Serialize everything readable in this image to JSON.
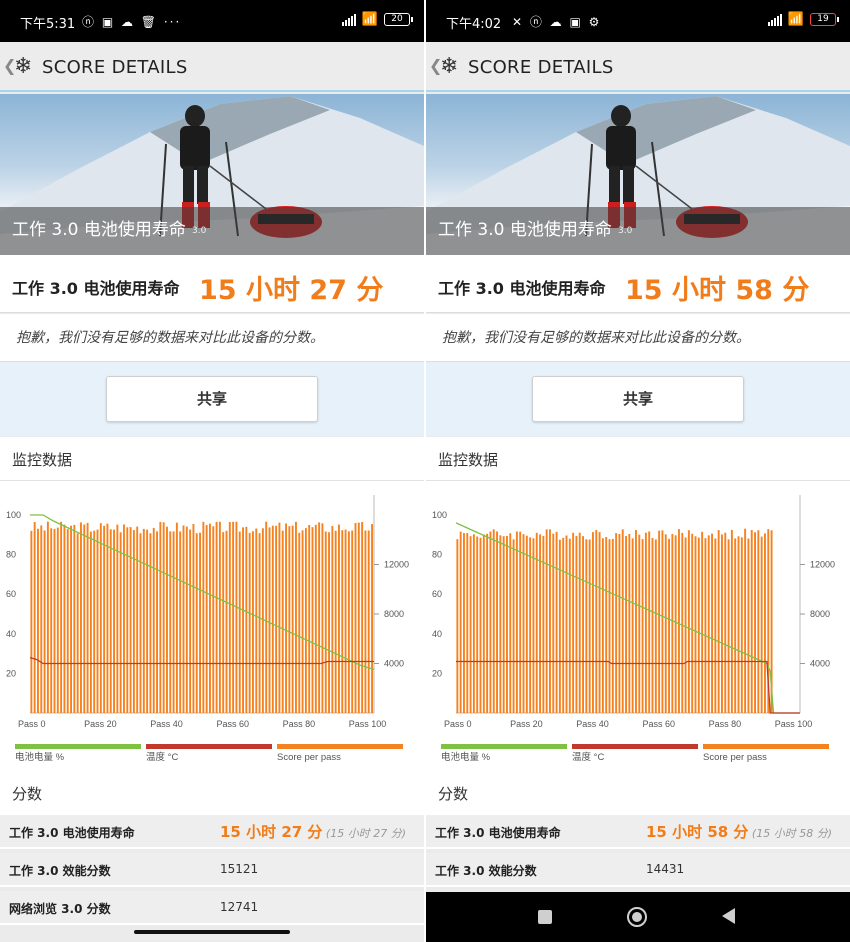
{
  "screens": [
    {
      "status": {
        "time": "下午5:31",
        "icons": "ⓝ ▣ ☁ 🗑 ···",
        "battery": "20"
      },
      "header": {
        "title": "SCORE DETAILS"
      },
      "hero": {
        "caption": "工作 3.0 电池使用寿命",
        "version": "3.0"
      },
      "score": {
        "label": "工作 3.0 电池使用寿命",
        "value": "15 小时 27 分"
      },
      "notice": "抱歉，我们没有足够的数据来对比此设备的分数。",
      "share_label": "共享",
      "monitor_title": "监控数据",
      "scores_title": "分数",
      "rows": [
        {
          "label": "工作 3.0 电池使用寿命",
          "value": "15 小时 27 分",
          "sub": "(15 小时 27 分)"
        },
        {
          "label": "工作 3.0 效能分数",
          "value": "15121"
        },
        {
          "label": "网络浏览 3.0 分数",
          "value": "12741"
        }
      ],
      "chart_data": {
        "type": "bar",
        "x_ticks": [
          "Pass 0",
          "Pass 20",
          "Pass 40",
          "Pass 60",
          "Pass 80",
          "Pass 100"
        ],
        "x_range": [
          0,
          104
        ],
        "y_left_ticks": [
          "100",
          "80",
          "60",
          "40",
          "20"
        ],
        "y_left_range": [
          0,
          100
        ],
        "y_right_ticks": [
          "12000",
          "8000",
          "4000"
        ],
        "y_right_range": [
          0,
          16000
        ],
        "legend": [
          "电池电量 %",
          "温度 °C",
          "Score per pass"
        ],
        "series": [
          {
            "name": "电池电量 %",
            "color": "#7dc242",
            "points": [
              [
                0,
                100
              ],
              [
                4,
                100
              ],
              [
                7,
                97
              ],
              [
                100,
                24
              ],
              [
                104,
                22
              ]
            ]
          },
          {
            "name": "温度 °C",
            "color": "#c0392b",
            "points": [
              [
                0,
                28
              ],
              [
                2,
                27
              ],
              [
                4,
                25
              ],
              [
                88,
                25
              ],
              [
                90,
                26
              ],
              [
                104,
                26
              ]
            ]
          },
          {
            "name": "Score per pass",
            "color": "#f58220",
            "bar_count": 104,
            "typical": 15121,
            "range": [
              14500,
              15500
            ]
          }
        ]
      }
    },
    {
      "status": {
        "time": "下午4:02",
        "icons": "✕ ⓝ ☁ ▣ ⚙",
        "battery": "19"
      },
      "header": {
        "title": "SCORE DETAILS"
      },
      "hero": {
        "caption": "工作 3.0 电池使用寿命",
        "version": "3.0"
      },
      "score": {
        "label": "工作 3.0 电池使用寿命",
        "value": "15 小时 58 分"
      },
      "notice": "抱歉，我们没有足够的数据来对比此设备的分数。",
      "share_label": "共享",
      "monitor_title": "监控数据",
      "scores_title": "分数",
      "rows": [
        {
          "label": "工作 3.0 电池使用寿命",
          "value": "15 小时 58 分",
          "sub": "(15 小时 58 分)"
        },
        {
          "label": "工作 3.0 效能分数",
          "value": "14431"
        }
      ],
      "chart_data": {
        "type": "bar",
        "x_ticks": [
          "Pass 0",
          "Pass 20",
          "Pass 40",
          "Pass 60",
          "Pass 80",
          "Pass 100"
        ],
        "x_range": [
          0,
          104
        ],
        "y_left_ticks": [
          "100",
          "80",
          "60",
          "40",
          "20"
        ],
        "y_left_range": [
          0,
          100
        ],
        "y_right_ticks": [
          "12000",
          "8000",
          "4000"
        ],
        "y_right_range": [
          0,
          16000
        ],
        "legend": [
          "电池电量 %",
          "温度 °C",
          "Score per pass"
        ],
        "series": [
          {
            "name": "电池电量 %",
            "color": "#7dc242",
            "points": [
              [
                0,
                96
              ],
              [
                94,
                25
              ],
              [
                95,
                21
              ],
              [
                96,
                0
              ],
              [
                104,
                0
              ]
            ]
          },
          {
            "name": "温度 °C",
            "color": "#c0392b",
            "points": [
              [
                0,
                26
              ],
              [
                46,
                26
              ],
              [
                47,
                25
              ],
              [
                69,
                25
              ],
              [
                70,
                26
              ],
              [
                94,
                26
              ],
              [
                95,
                0
              ],
              [
                104,
                0
              ]
            ]
          },
          {
            "name": "Score per pass",
            "color": "#f58220",
            "bar_count": 96,
            "typical": 14431,
            "range": [
              14000,
              14900
            ]
          }
        ]
      }
    }
  ]
}
